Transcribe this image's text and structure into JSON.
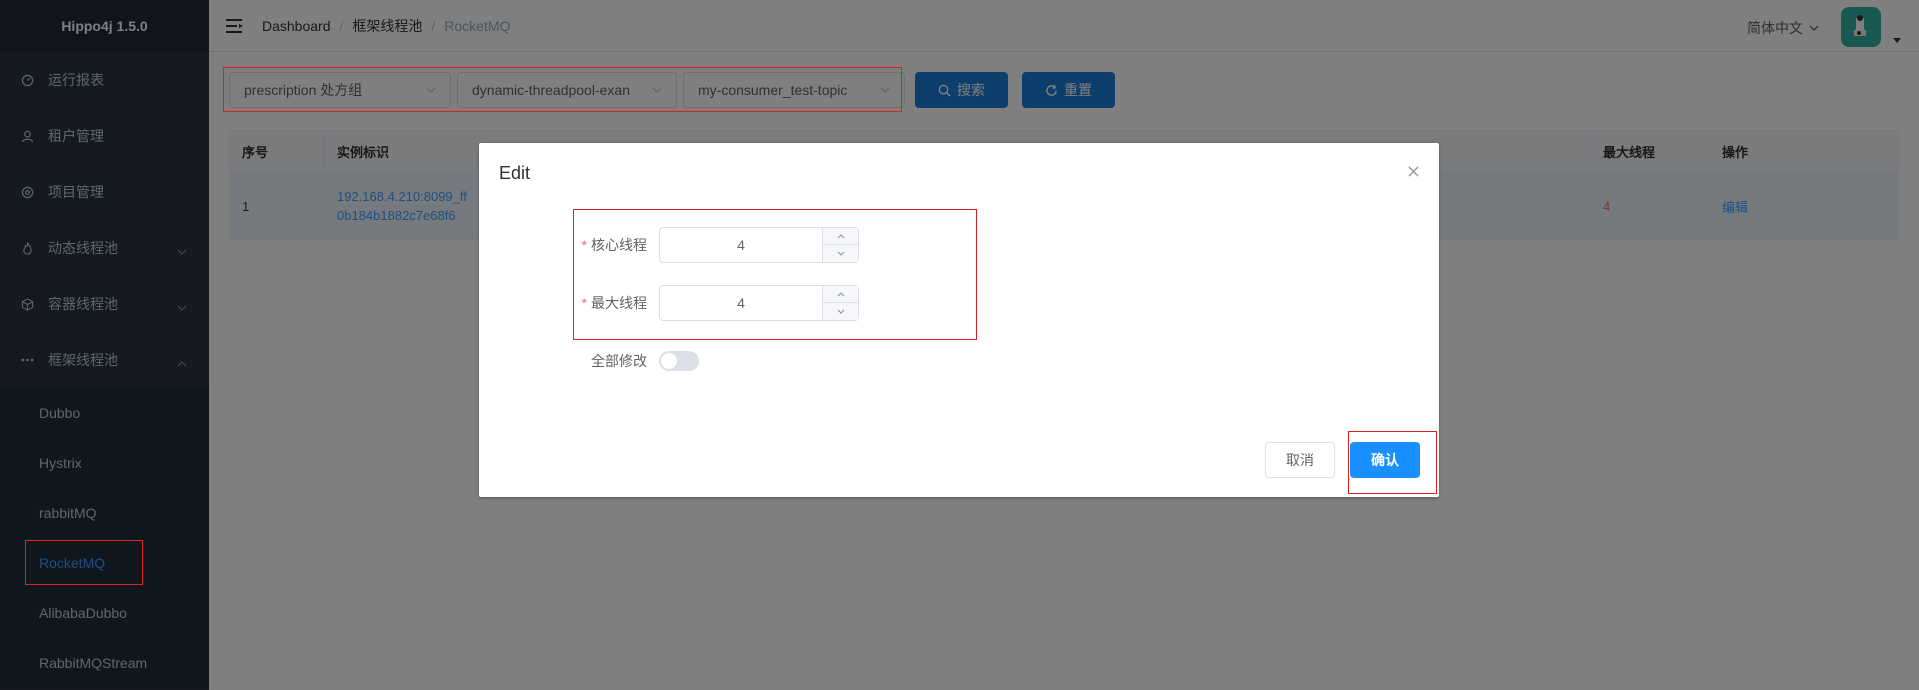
{
  "app": {
    "title": "Hippo4j 1.5.0"
  },
  "sidebar": {
    "items": [
      {
        "label": "运行报表",
        "icon": "dashboard-icon"
      },
      {
        "label": "租户管理",
        "icon": "user-icon"
      },
      {
        "label": "项目管理",
        "icon": "project-icon"
      },
      {
        "label": "动态线程池",
        "icon": "flame-icon",
        "expandable": true
      },
      {
        "label": "容器线程池",
        "icon": "cube-icon",
        "expandable": true
      },
      {
        "label": "框架线程池",
        "icon": "more-icon",
        "expandable": true,
        "expanded": true
      }
    ],
    "subitems": [
      "Dubbo",
      "Hystrix",
      "rabbitMQ",
      "RocketMQ",
      "AlibabaDubbo",
      "RabbitMQStream"
    ],
    "active_subitem": "RocketMQ"
  },
  "navbar": {
    "breadcrumb": [
      "Dashboard",
      "框架线程池",
      "RocketMQ"
    ],
    "language": "简体中文"
  },
  "filters": {
    "tenant": "prescription 处方组",
    "item": "dynamic-threadpool-exan",
    "threadpool": "my-consumer_test-topic",
    "search_label": "搜索",
    "reset_label": "重置"
  },
  "table": {
    "columns": [
      "序号",
      "实例标识",
      "",
      "",
      "",
      "最大线程",
      "操作"
    ],
    "rows": [
      {
        "index": "1",
        "instance_line1": "192.168.4.210:8099_ff",
        "instance_line2": "0b184b1882c7e68f6",
        "max_threads": "4",
        "action": "编辑"
      }
    ]
  },
  "dialog": {
    "title": "Edit",
    "core_label": "核心线程",
    "core_value": "4",
    "max_label": "最大线程",
    "max_value": "4",
    "all_modify_label": "全部修改",
    "all_modify": false,
    "cancel_label": "取消",
    "confirm_label": "确认"
  },
  "colors": {
    "primary": "#1890ff",
    "sidebar": "#2b3544",
    "annotation": "#e02020"
  }
}
